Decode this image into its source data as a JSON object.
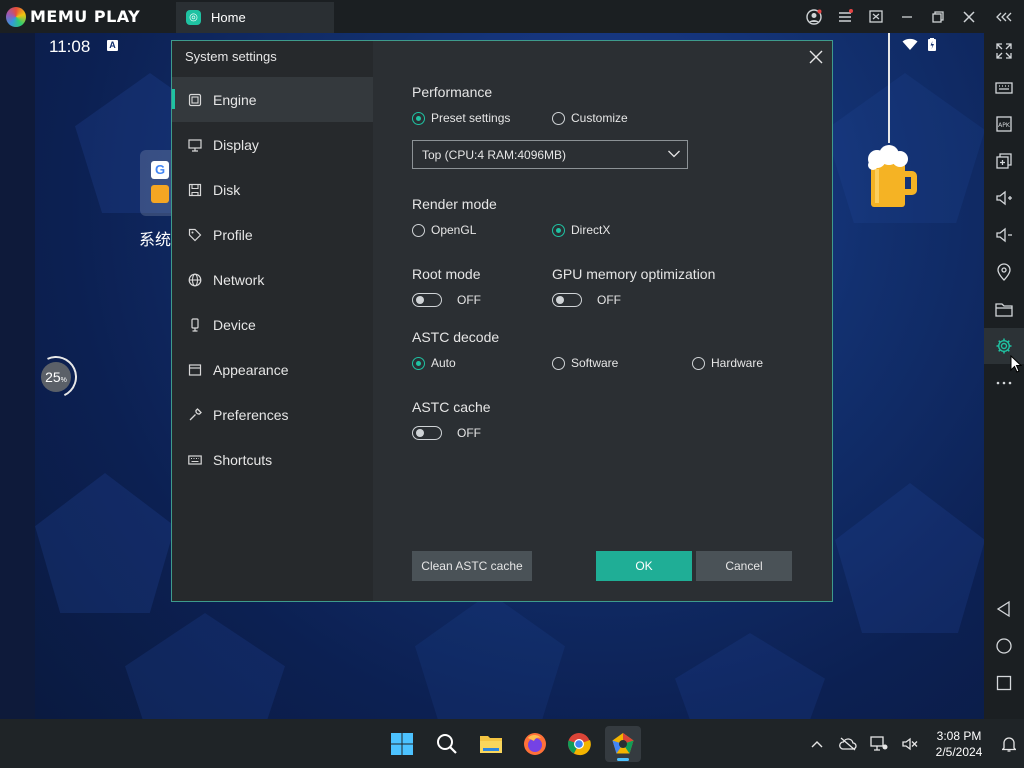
{
  "titlebar": {
    "logo_text": "MEMU PLAY",
    "home_tab": "Home"
  },
  "android": {
    "time": "11:08",
    "time_badge": "A",
    "app_label": "系统",
    "speed_value": "25",
    "speed_unit": "%"
  },
  "dialog": {
    "title": "System settings",
    "nav": [
      {
        "label": "Engine",
        "icon": "chip-icon"
      },
      {
        "label": "Display",
        "icon": "monitor-icon"
      },
      {
        "label": "Disk",
        "icon": "disk-icon"
      },
      {
        "label": "Profile",
        "icon": "tag-icon"
      },
      {
        "label": "Network",
        "icon": "globe-icon"
      },
      {
        "label": "Device",
        "icon": "phone-icon"
      },
      {
        "label": "Appearance",
        "icon": "window-icon"
      },
      {
        "label": "Preferences",
        "icon": "wrench-icon"
      },
      {
        "label": "Shortcuts",
        "icon": "keyboard-icon"
      }
    ],
    "active_nav": "Engine",
    "performance": {
      "label": "Performance",
      "preset": "Preset settings",
      "customize": "Customize",
      "selected": "Preset settings",
      "select_value": "Top (CPU:4 RAM:4096MB)"
    },
    "render_mode": {
      "label": "Render mode",
      "opengl": "OpenGL",
      "directx": "DirectX",
      "selected": "DirectX"
    },
    "root_mode": {
      "label": "Root mode",
      "state": "OFF"
    },
    "gpu_memory": {
      "label": "GPU memory optimization",
      "state": "OFF"
    },
    "astc_decode": {
      "label": "ASTC decode",
      "auto": "Auto",
      "software": "Software",
      "hardware": "Hardware",
      "selected": "Auto"
    },
    "astc_cache": {
      "label": "ASTC cache",
      "state": "OFF"
    },
    "buttons": {
      "clean": "Clean ASTC cache",
      "ok": "OK",
      "cancel": "Cancel"
    }
  },
  "taskbar": {
    "time": "3:08 PM",
    "date": "2/5/2024"
  },
  "colors": {
    "accent": "#1fc2a2",
    "dialog_bg": "#2b2f33",
    "sidebar_bg": "#26292c",
    "button_gray": "#4a5257"
  }
}
